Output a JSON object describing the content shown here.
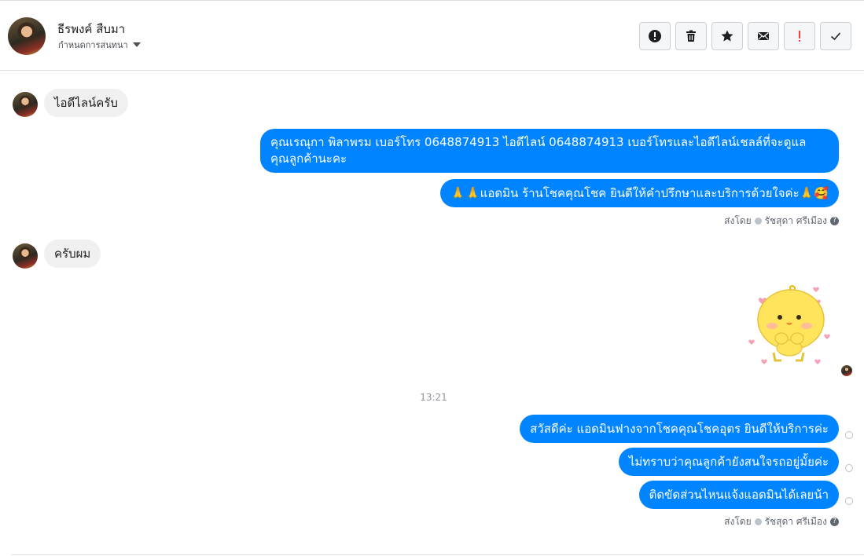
{
  "header": {
    "name": "ธีรพงค์ สืบมา",
    "subtitle": "กำหนดการสนทนา",
    "toolbar": [
      {
        "icon": "alert-circle-icon"
      },
      {
        "icon": "trash-icon"
      },
      {
        "icon": "star-icon"
      },
      {
        "icon": "envelope-icon"
      },
      {
        "icon": "exclamation-icon",
        "color": "#fa3e3e"
      },
      {
        "icon": "check-icon"
      }
    ]
  },
  "messages": {
    "in_1": "ไอดีไลน์ครับ",
    "out_1": "คุณเรณุกา พิลาพรม        เบอร์โทร 0648874913  ไอดีไลน์ 0648874913   เบอร์โทรและไอดีไลน์เชลล์ที่จะดูแล คุณลูกค้านะคะ",
    "out_2": "🙏🙏แอดมิน ร้านโชคคุณโชค ยินดีให้คำปรึกษาและบริการด้วยใจค่ะ🙏🥰",
    "sent_by_1_prefix": "ส่งโดย",
    "sent_by_1_name": "รัชสุดา ศรีเมือง",
    "in_2": "ครับผม",
    "timestamp": "13:21",
    "out_3": "สวัสดีค่ะ แอดมินฟางจากโชคคุณโชคอุตร ยินดีให้บริการค่ะ",
    "out_4": "ไม่ทราบว่าคุณลูกค้ายังสนใจรถอยู่มั้ยค่ะ",
    "out_5": "ติดขัดส่วนไหนแจ้งแอดมินได้เลยน้า",
    "sent_by_2_prefix": "ส่งโดย",
    "sent_by_2_name": "รัชสุดา ศรีเมือง"
  },
  "colors": {
    "outgoing_bubble": "#0084ff",
    "incoming_bubble": "#f1f0f0",
    "alert_red": "#fa3e3e"
  }
}
